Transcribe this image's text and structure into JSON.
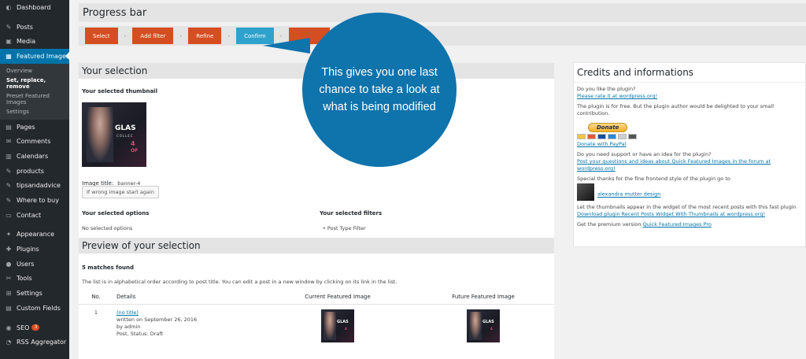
{
  "sidebar": {
    "items": [
      {
        "icon": "dashboard-icon",
        "glyph": "◐",
        "label": "Dashboard"
      },
      {
        "icon": "pin-icon",
        "glyph": "✎",
        "label": "Posts"
      },
      {
        "icon": "media-icon",
        "glyph": "▣",
        "label": "Media"
      },
      {
        "icon": "featured-images-icon",
        "glyph": "▦",
        "label": "Featured Images"
      },
      {
        "icon": "pages-icon",
        "glyph": "▤",
        "label": "Pages"
      },
      {
        "icon": "comments-icon",
        "glyph": "✉",
        "label": "Comments"
      },
      {
        "icon": "calendar-icon",
        "glyph": "▥",
        "label": "Calendars"
      },
      {
        "icon": "pin-icon",
        "glyph": "✎",
        "label": "products"
      },
      {
        "icon": "pin-icon",
        "glyph": "✎",
        "label": "tipsandadvice"
      },
      {
        "icon": "pin-icon",
        "glyph": "✎",
        "label": "Where to buy"
      },
      {
        "icon": "contact-icon",
        "glyph": "▭",
        "label": "Contact"
      },
      {
        "icon": "appearance-icon",
        "glyph": "✦",
        "label": "Appearance"
      },
      {
        "icon": "plugins-icon",
        "glyph": "✚",
        "label": "Plugins"
      },
      {
        "icon": "users-icon",
        "glyph": "●",
        "label": "Users"
      },
      {
        "icon": "tools-icon",
        "glyph": "✂",
        "label": "Tools"
      },
      {
        "icon": "settings-icon",
        "glyph": "⊞",
        "label": "Settings"
      },
      {
        "icon": "custom-fields-icon",
        "glyph": "▤",
        "label": "Custom Fields"
      },
      {
        "icon": "seo-icon",
        "glyph": "◉",
        "label": "SEO",
        "badge": "3"
      },
      {
        "icon": "rss-icon",
        "glyph": "◔",
        "label": "RSS Aggregator"
      }
    ],
    "submenu": [
      "Overview",
      "Set, replace, remove",
      "Preset Featured Images",
      "Settings"
    ]
  },
  "header": {
    "title": "Progress bar"
  },
  "steps": [
    "Select",
    "Add filter",
    "Refine",
    "Confirm"
  ],
  "selection": {
    "heading": "Your selection",
    "thumb_label": "Your selected thumbnail",
    "thumb_text_1": "GLAS",
    "thumb_text_2": "COLLEC",
    "thumb_text_3": "4",
    "thumb_text_4": "OF",
    "image_title_label": "Image title:",
    "image_title_value": "banner-4",
    "wrong_image_button": "If wrong image start again",
    "options_label": "Your selected options",
    "options_value": "No selected options",
    "filters_label": "Your selected filters",
    "filters_value": "Post Type Filter"
  },
  "preview": {
    "heading": "Preview of your selection",
    "matches": "5 matches found",
    "note": "The list is in alphabetical order according to post title. You can edit a post in a new window by clicking on its link in the list.",
    "columns": [
      "No.",
      "Details",
      "Current Featured Image",
      "Future Featured Image"
    ],
    "rows": [
      {
        "no": "1",
        "title": "(no title)",
        "written": "written on September 26, 2016",
        "by": "by admin",
        "status": "Post, Status: Draft"
      }
    ],
    "mini_thumb_text": "GLAS",
    "mini_thumb_num": "4"
  },
  "credits": {
    "heading": "Credits and informations",
    "like": "Do you like the plugin?",
    "rate_link": "Please rate it at wordpress.org!",
    "free": "The plugin is for free. But the plugin author would be delighted to your small contribution.",
    "donate_button": "Donate",
    "donate_link": "Donate with PayPal",
    "support": "Do you need support or have an idea for the plugin?",
    "forum_link": "Post your questions and ideas about Quick Featured Images in the forum at wordpress.org!",
    "thanks": "Special thanks for the fine frontend style of the plugin go to",
    "designer_link": "alexandra mutter design",
    "thumbs_text": "Let the thumbnails appear in the widget of the most recent posts with this fast plugin",
    "download_link": "Download plugin Recent Posts Widget With Thumbnails at wordpress.org!",
    "premium_text": "Get the premium version",
    "premium_link": "Quick Featured Images Pro"
  },
  "callout": {
    "text": "This gives you one last chance to take a look at what is being modified"
  }
}
